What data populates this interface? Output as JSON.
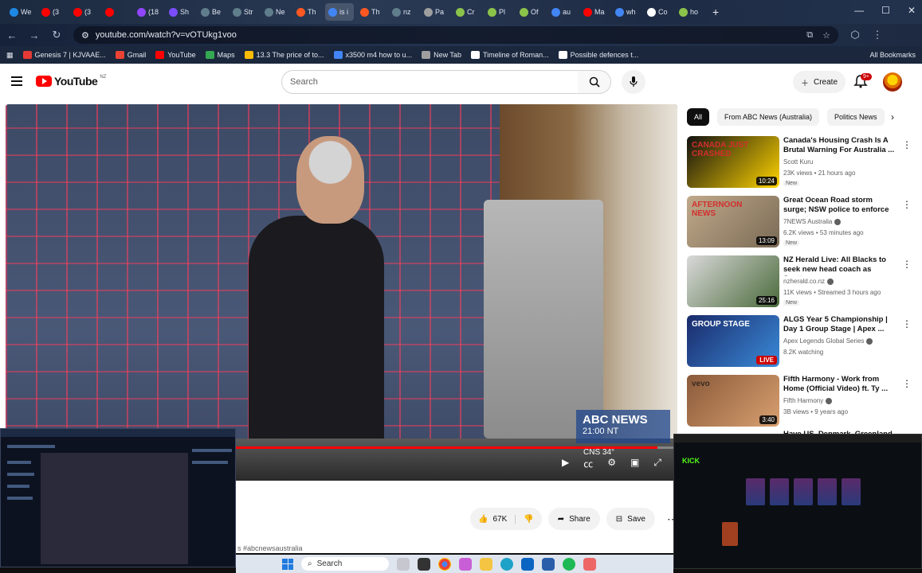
{
  "browser": {
    "tabs": [
      {
        "label": "We",
        "color": "#1e88e5",
        "active": false
      },
      {
        "label": "(3",
        "color": "#ff0000",
        "active": false
      },
      {
        "label": "(3",
        "color": "#ff0000",
        "active": false
      },
      {
        "label": "",
        "color": "#ff0000",
        "active": false
      },
      {
        "label": "(18",
        "color": "#9146ff",
        "active": false
      },
      {
        "label": "Sh",
        "color": "#7b4dff",
        "active": false
      },
      {
        "label": "Be",
        "color": "#607d8b",
        "active": false
      },
      {
        "label": "Str",
        "color": "#607d8b",
        "active": false
      },
      {
        "label": "Ne",
        "color": "#607d8b",
        "active": false
      },
      {
        "label": "Th",
        "color": "#ff5722",
        "active": false
      },
      {
        "label": "is i",
        "color": "#4285f4",
        "active": true
      },
      {
        "label": "Th",
        "color": "#ff5722",
        "active": false
      },
      {
        "label": "nz",
        "color": "#607d8b",
        "active": false
      },
      {
        "label": "Pa",
        "color": "#9e9e9e",
        "active": false
      },
      {
        "label": "Cr",
        "color": "#8bc34a",
        "active": false
      },
      {
        "label": "Pl",
        "color": "#8bc34a",
        "active": false
      },
      {
        "label": "Of",
        "color": "#8bc34a",
        "active": false
      },
      {
        "label": "au",
        "color": "#4285f4",
        "active": false
      },
      {
        "label": "Ma",
        "color": "#ff0000",
        "active": false
      },
      {
        "label": "wh",
        "color": "#4285f4",
        "active": false
      },
      {
        "label": "Co",
        "color": "#ffffff",
        "active": false
      },
      {
        "label": "ho",
        "color": "#8bc34a",
        "active": false
      }
    ],
    "new_tab": "+",
    "url": "youtube.com/watch?v=vOTUkg1voo",
    "bookmarks": [
      {
        "label": "Genesis 7 | KJVAAE...",
        "color": "#e53935"
      },
      {
        "label": "Gmail",
        "color": "#ea4335"
      },
      {
        "label": "YouTube",
        "color": "#ff0000"
      },
      {
        "label": "Maps",
        "color": "#34a853"
      },
      {
        "label": "13.3 The price of to...",
        "color": "#fbbc05"
      },
      {
        "label": "x3500 m4 how to u...",
        "color": "#4285f4"
      },
      {
        "label": "New Tab",
        "color": "#9e9e9e"
      },
      {
        "label": "Timeline of Roman...",
        "color": "#ffffff"
      },
      {
        "label": "Possible defences t...",
        "color": "#ffffff"
      }
    ],
    "all_bookmarks": "All Bookmarks"
  },
  "youtube": {
    "logo_text": "YouTube",
    "logo_country": "NZ",
    "search_placeholder": "Search",
    "create_label": "Create",
    "notification_count": "9+",
    "player": {
      "news_bug_line1": "ABC NEWS",
      "news_bug_line2": "21:00 NT",
      "weather": "CNS  34°",
      "progress": 0.97
    },
    "actions": {
      "likes": "67K",
      "share": "Share",
      "save": "Save"
    },
    "hashtag_text": "s #abcnewsaustralia",
    "chips": [
      "All",
      "From ABC News (Australia)",
      "Politics News"
    ],
    "recommendations": [
      {
        "title": "Canada's Housing Crash Is A Brutal Warning For Australia ...",
        "channel": "Scott Kuru",
        "verified": false,
        "meta": "23K views • 21 hours ago",
        "badge": "New",
        "duration": "10:24",
        "live": false,
        "thumb_text": "CANADA JUST CRASHED",
        "thumb_colors": [
          "#111111",
          "#ffd400",
          "#d32f2f"
        ]
      },
      {
        "title": "Great Ocean Road storm surge; NSW police to enforce protest ...",
        "channel": "7NEWS Australia",
        "verified": true,
        "meta": "6.2K views • 53 minutes ago",
        "badge": "New",
        "duration": "13:09",
        "live": false,
        "thumb_text": "AFTERNOON NEWS",
        "thumb_colors": [
          "#c0a98a",
          "#7a6a55",
          "#d32f2f"
        ]
      },
      {
        "title": "NZ Herald Live: All Blacks to seek new head coach as Scott...",
        "channel": "nzherald.co.nz",
        "verified": true,
        "meta": "11K views • Streamed 3 hours ago",
        "badge": "New",
        "duration": "25:16",
        "live": false,
        "thumb_text": "",
        "thumb_colors": [
          "#d9d9d9",
          "#4a6a3a",
          "#202020"
        ]
      },
      {
        "title": "ALGS Year 5 Championship | Day 1 Group Stage | Apex ...",
        "channel": "Apex Legends Global Series",
        "verified": true,
        "meta": "8.2K watching",
        "badge": "",
        "duration": "",
        "live": true,
        "live_label": "LIVE",
        "thumb_text": "GROUP STAGE",
        "thumb_colors": [
          "#1a2a6a",
          "#3a8ad8",
          "#ffffff"
        ]
      },
      {
        "title": "Fifth Harmony - Work from Home (Official Video) ft. Ty ...",
        "channel": "Fifth Harmony",
        "verified": true,
        "meta": "3B views • 9 years ago",
        "badge": "",
        "duration": "3:40",
        "live": false,
        "thumb_text": "vevo",
        "thumb_colors": [
          "#8a5a3a",
          "#d9a070",
          "#3a2a20"
        ]
      }
    ],
    "partial_rec_title": "Have US, Denmark, Greenland"
  },
  "overlay": {
    "right_logo": "KICK"
  },
  "taskbar": {
    "search_label": "Search"
  }
}
